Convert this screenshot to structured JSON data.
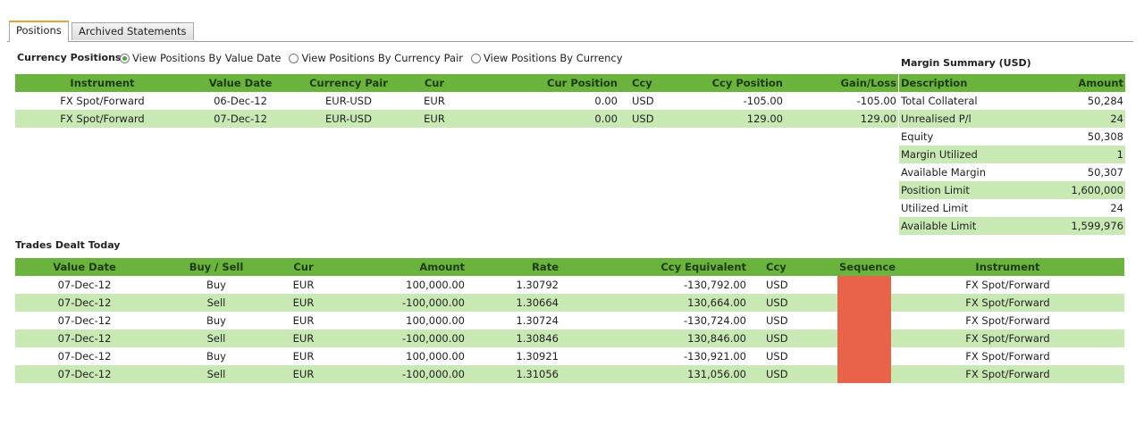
{
  "tabs": [
    {
      "label": "Positions",
      "active": true
    },
    {
      "label": "Archived Statements",
      "active": false
    }
  ],
  "currency_positions": {
    "title": "Currency Positions",
    "radio_options": [
      {
        "label": "View Positions By Value Date",
        "checked": true
      },
      {
        "label": "View Positions By Currency Pair",
        "checked": false
      },
      {
        "label": "View Positions By Currency",
        "checked": false
      }
    ],
    "columns": [
      "Instrument",
      "Value Date",
      "Currency Pair",
      "Cur",
      "Cur Position",
      "Ccy",
      "Ccy Position",
      "Gain/Loss"
    ],
    "rows": [
      [
        "FX Spot/Forward",
        "06-Dec-12",
        "EUR-USD",
        "EUR",
        "0.00",
        "USD",
        "-105.00",
        "-105.00"
      ],
      [
        "FX Spot/Forward",
        "07-Dec-12",
        "EUR-USD",
        "EUR",
        "0.00",
        "USD",
        "129.00",
        "129.00"
      ]
    ]
  },
  "margin_summary": {
    "title": "Margin Summary (USD)",
    "columns": [
      "Description",
      "Amount"
    ],
    "rows": [
      [
        "Total Collateral",
        "50,284"
      ],
      [
        "Unrealised P/l",
        "24"
      ],
      [
        "Equity",
        "50,308"
      ],
      [
        "Margin Utilized",
        "1"
      ],
      [
        "Available Margin",
        "50,307"
      ],
      [
        "Position Limit",
        "1,600,000"
      ],
      [
        "Utilized Limit",
        "24"
      ],
      [
        "Available Limit",
        "1,599,976"
      ]
    ]
  },
  "trades": {
    "title": "Trades Dealt Today",
    "columns": [
      "Value Date",
      "Buy / Sell",
      "Cur",
      "Amount",
      "Rate",
      "Ccy Equivalent",
      "Ccy",
      "Sequence",
      "Instrument"
    ],
    "rows": [
      [
        "07-Dec-12",
        "Buy",
        "EUR",
        "100,000.00",
        "1.30792",
        "-130,792.00",
        "USD",
        "",
        "FX Spot/Forward"
      ],
      [
        "07-Dec-12",
        "Sell",
        "EUR",
        "-100,000.00",
        "1.30664",
        "130,664.00",
        "USD",
        "",
        "FX Spot/Forward"
      ],
      [
        "07-Dec-12",
        "Buy",
        "EUR",
        "100,000.00",
        "1.30724",
        "-130,724.00",
        "USD",
        "",
        "FX Spot/Forward"
      ],
      [
        "07-Dec-12",
        "Sell",
        "EUR",
        "-100,000.00",
        "1.30846",
        "130,846.00",
        "USD",
        "",
        "FX Spot/Forward"
      ],
      [
        "07-Dec-12",
        "Buy",
        "EUR",
        "100,000.00",
        "1.30921",
        "-130,921.00",
        "USD",
        "",
        "FX Spot/Forward"
      ],
      [
        "07-Dec-12",
        "Sell",
        "EUR",
        "-100,000.00",
        "1.31056",
        "131,056.00",
        "USD",
        "",
        "FX Spot/Forward"
      ]
    ]
  },
  "colors": {
    "header_green": "#6ab43e",
    "row_alt_green": "#c8e8b4",
    "sequence_redacted": "#e8634a",
    "tab_accent": "#e8a23a"
  }
}
